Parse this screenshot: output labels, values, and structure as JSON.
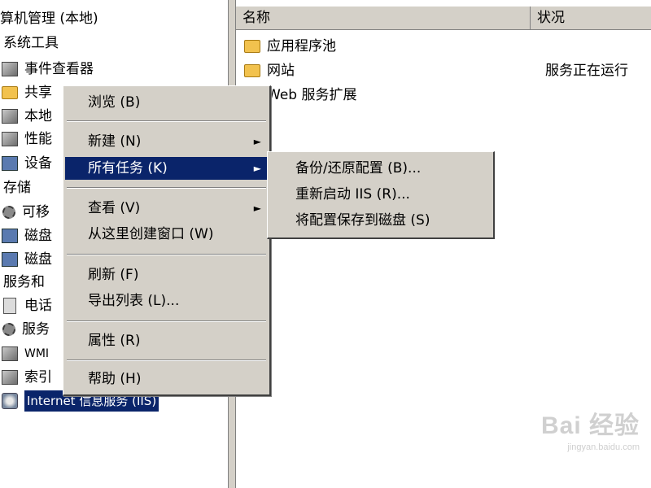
{
  "tree": {
    "items": [
      {
        "label": "算机管理 (本地)",
        "icon": "computer-management-icon"
      },
      {
        "label": "系统工具",
        "icon": ""
      },
      {
        "label": "事件查看器",
        "icon": "event-viewer-icon"
      },
      {
        "label": "共享",
        "icon": "shared-folder-icon"
      },
      {
        "label": "本地",
        "icon": "local-users-icon"
      },
      {
        "label": "性能",
        "icon": "performance-icon"
      },
      {
        "label": "设备",
        "icon": "device-manager-icon"
      },
      {
        "label": "存储",
        "icon": ""
      },
      {
        "label": "可移",
        "icon": "removable-storage-icon"
      },
      {
        "label": "磁盘",
        "icon": "disk-defrag-icon"
      },
      {
        "label": "磁盘",
        "icon": "disk-management-icon"
      },
      {
        "label": "服务和",
        "icon": ""
      },
      {
        "label": "电话",
        "icon": "telephony-icon"
      },
      {
        "label": "服务",
        "icon": "services-icon"
      },
      {
        "label": "WMI",
        "icon": "wmi-control-icon"
      },
      {
        "label": "索引",
        "icon": "indexing-service-icon"
      },
      {
        "label": "Internet 信息服务 (IIS)",
        "icon": "iis-icon"
      }
    ]
  },
  "list": {
    "columns": [
      "名称",
      "状况"
    ],
    "rows": [
      {
        "name": "应用程序池",
        "status": "",
        "icon": "folder-icon"
      },
      {
        "name": "网站",
        "status": "服务正在运行",
        "icon": "folder-icon"
      },
      {
        "name": "Web 服务扩展",
        "status": "",
        "icon": "folder-icon"
      }
    ]
  },
  "context_menu": {
    "items": [
      {
        "label": "浏览 (B)"
      },
      {
        "label": "新建 (N)",
        "submenu": true
      },
      {
        "label": "所有任务 (K)",
        "submenu": true,
        "highlighted": true
      },
      {
        "label": "查看 (V)",
        "submenu": true
      },
      {
        "label": "从这里创建窗口 (W)"
      },
      {
        "label": "刷新 (F)"
      },
      {
        "label": "导出列表 (L)..."
      },
      {
        "label": "属性 (R)"
      },
      {
        "label": "帮助 (H)"
      }
    ],
    "arrow": "►"
  },
  "sub_menu": {
    "items": [
      {
        "label": "备份/还原配置 (B)..."
      },
      {
        "label": "重新启动 IIS (R)..."
      },
      {
        "label": "将配置保存到磁盘 (S)"
      }
    ]
  },
  "watermark": {
    "main": "Bai 经验",
    "sub": "jingyan.baidu.com"
  },
  "colors": {
    "selection": "#0a246a",
    "menu_bg": "#d4d0c8"
  }
}
